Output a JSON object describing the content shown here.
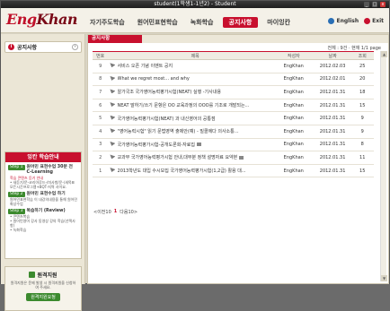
{
  "window": {
    "title": "student(1학생1-1년2) - Student",
    "controls": [
      "_",
      "□",
      "x"
    ]
  },
  "header": {
    "logo": {
      "a": "Eng",
      "b": "Khan"
    },
    "nav": [
      {
        "label": "자기주도학습",
        "active": false
      },
      {
        "label": "원어민표현학습",
        "active": false
      },
      {
        "label": "녹화학습",
        "active": false
      },
      {
        "label": "공지사항",
        "active": true
      },
      {
        "label": "마이잉칸",
        "active": false
      }
    ],
    "english_label": "English",
    "exit_label": "Exit"
  },
  "sidebar": {
    "title": "공지사항",
    "guide": {
      "header": "잉칸 학습안내",
      "steps": [
        {
          "badge": "Step 1",
          "title": "원어민 표현수업 30분 전 C-Learning",
          "subs": [
            {
              "text": "학습 콘텐츠 듣기 안내",
              "red": true
            },
            {
              "text": "• 새듣기/문-코리아루드-/미사항/운-/새목표\n모든시간프로그램+BQT-지역 사이요."
            }
          ]
        },
        {
          "badge": "Step 2",
          "title": "원어민 표현수업 하기",
          "subs": [
            {
              "text": "원어민표현학습 이 내강의내용을 통해 원어민 화상수업"
            }
          ]
        },
        {
          "badge": "Step 3",
          "title": "복습하기 (Review)",
          "subs": [
            {
              "text": "• 콘텐츠복습"
            },
            {
              "text": "• 원어민영어 강사 동영상 강의 학습(선택사항)"
            },
            {
              "text": "• 녹화학습"
            }
          ]
        }
      ]
    },
    "support": {
      "title": "원격지원",
      "desc": "원격지원은 문제 발생 시 원격지원을 신청하여 주세요.",
      "button": "원격지원요청"
    }
  },
  "content": {
    "tab": "공지사항",
    "count": "전체 : 9건 · 현재 1/1 page",
    "columns": {
      "num": "번호",
      "title": "제목",
      "author": "작성자",
      "date": "날짜",
      "views": "조회"
    },
    "rows": [
      {
        "num": "9",
        "title": "서비스 오픈 기념 이벤트 공지",
        "author": "EngKhan",
        "date": "2012.02.03",
        "views": "25",
        "attach": false
      },
      {
        "num": "8",
        "title": "What we regret most... and why",
        "author": "EngKhan",
        "date": "2012.02.01",
        "views": "20",
        "attach": false
      },
      {
        "num": "7",
        "title": "알가국조 국가영어능력평가시험(NEAT) 실행 -기사내용",
        "author": "EngKhan",
        "date": "2012.01.31",
        "views": "18",
        "attach": false
      },
      {
        "num": "6",
        "title": "NEAT 말하기/쓰기 문항은 OO 교육과정의 OOO를 기조로 개발되는...",
        "author": "EngKhan",
        "date": "2012.01.31",
        "views": "15",
        "attach": false
      },
      {
        "num": "5",
        "title": "국가영어능력평가시험(NEAT) 과 내신영어의 공통점",
        "author": "EngKhan",
        "date": "2012.01.31",
        "views": "9",
        "attach": false
      },
      {
        "num": "4",
        "title": "\"영어능력시험\" 읽기 문법영역 출제안(예) - 빌콜에다 의사소통...",
        "author": "EngKhan",
        "date": "2012.01.31",
        "views": "9",
        "attach": false
      },
      {
        "num": "3",
        "title": "국가영어능력평가시험-공개도론회-자료집",
        "author": "EngKhan",
        "date": "2012.01.31",
        "views": "8",
        "attach": true
      },
      {
        "num": "2",
        "title": "교과부 국가영어능력평가시험 안내,대부분 정책 설명자료 요약본",
        "author": "EngKhan",
        "date": "2012.01.31",
        "views": "11",
        "attach": true
      },
      {
        "num": "1",
        "title": "2013학년도 대입 수시모집 국가영어능력평가시험(1,2급) 활용 대...",
        "author": "EngKhan",
        "date": "2012.01.31",
        "views": "15",
        "attach": false
      }
    ],
    "pager": {
      "prev": "<이전10",
      "current": "1",
      "next": "다음10>"
    }
  }
}
